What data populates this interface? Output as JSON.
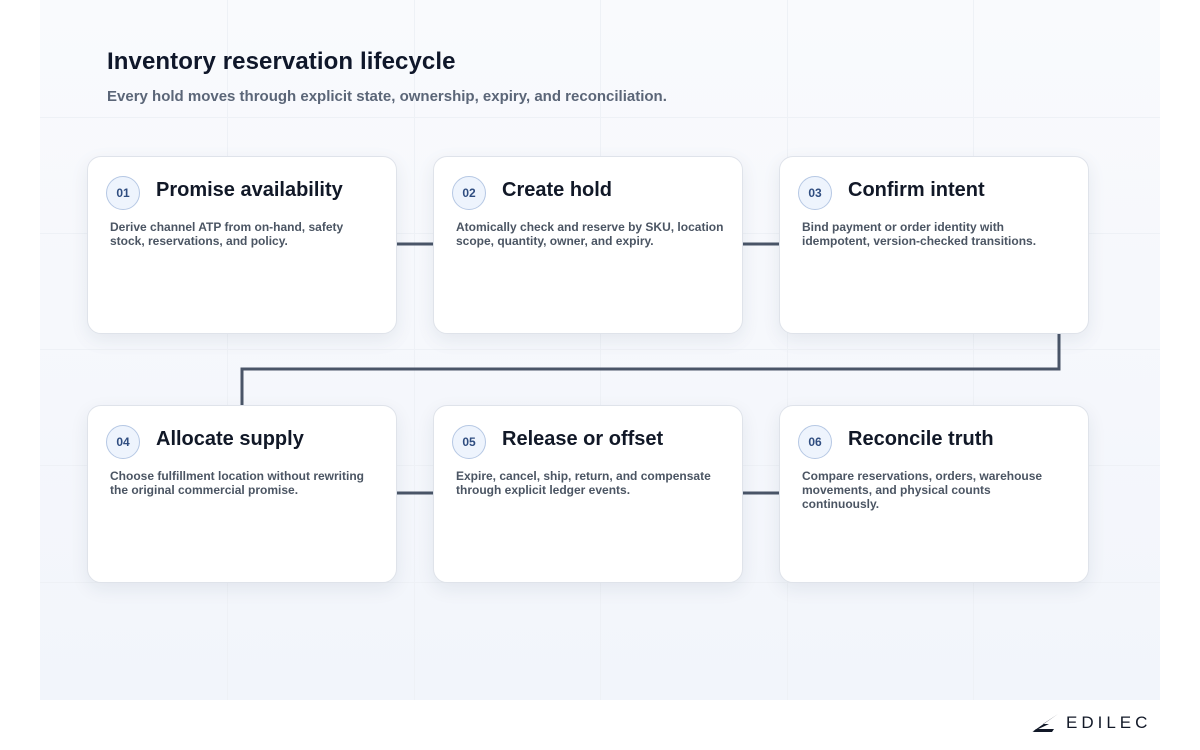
{
  "header": {
    "title": "Inventory reservation lifecycle",
    "subtitle": "Every hold moves through explicit state, ownership, expiry, and reconciliation."
  },
  "steps": [
    {
      "number": "01",
      "title": "Promise availability",
      "description": "Derive channel ATP from on-hand, safety stock, reservations, and policy."
    },
    {
      "number": "02",
      "title": "Create hold",
      "description": "Atomically check and reserve by SKU, location scope, quantity, owner, and expiry."
    },
    {
      "number": "03",
      "title": "Confirm intent",
      "description": "Bind payment or order identity with idempotent, version-checked transitions."
    },
    {
      "number": "04",
      "title": "Allocate supply",
      "description": "Choose fulfillment location without rewriting the original commercial promise."
    },
    {
      "number": "05",
      "title": "Release or offset",
      "description": "Expire, cancel, ship, return, and compensate through explicit ledger events."
    },
    {
      "number": "06",
      "title": "Reconcile truth",
      "description": "Compare reservations, orders, warehouse movements, and physical counts continuously."
    }
  ],
  "logo": {
    "text": "EDILEC"
  },
  "colors": {
    "connector": "#4a5568",
    "badge_border": "#b6c8e4",
    "badge_text": "#2f4d80",
    "title": "#0f172a"
  }
}
